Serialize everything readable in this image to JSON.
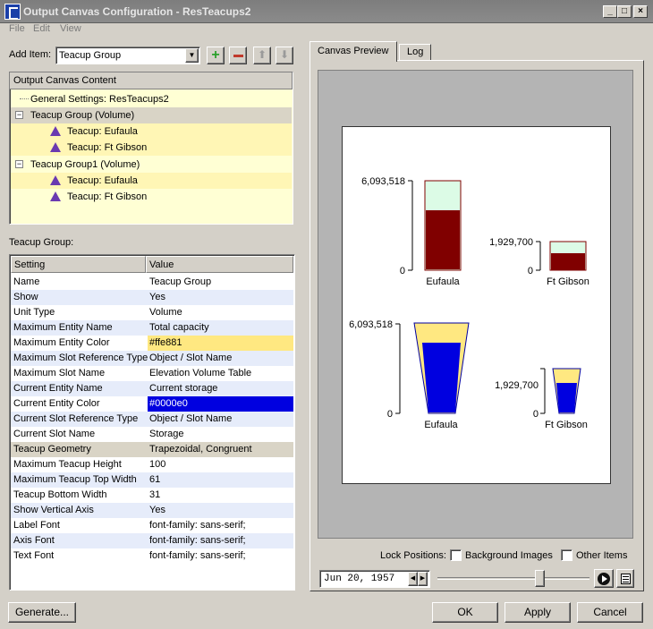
{
  "window": {
    "title": "Output Canvas Configuration - ResTeacups2"
  },
  "menu": [
    "File",
    "Edit",
    "View"
  ],
  "add_item": {
    "label": "Add Item:",
    "value": "Teacup Group"
  },
  "tree": {
    "header": "Output Canvas Content",
    "items": [
      {
        "label": "General Settings: ResTeacups2"
      },
      {
        "label": "Teacup Group (Volume)"
      },
      {
        "label": "Teacup: Eufaula"
      },
      {
        "label": "Teacup: Ft Gibson"
      },
      {
        "label": "Teacup Group1 (Volume)"
      },
      {
        "label": "Teacup: Eufaula"
      },
      {
        "label": "Teacup: Ft Gibson"
      }
    ]
  },
  "props": {
    "section_label": "Teacup Group:",
    "col_setting": "Setting",
    "col_value": "Value",
    "rows": [
      {
        "k": "Name",
        "v": "Teacup Group"
      },
      {
        "k": "Show",
        "v": "Yes"
      },
      {
        "k": "Unit Type",
        "v": "Volume"
      },
      {
        "k": "Maximum Entity Name",
        "v": "Total capacity"
      },
      {
        "k": "Maximum Entity Color",
        "v": "#ffe881"
      },
      {
        "k": "Maximum Slot Reference Type",
        "v": "Object / Slot Name"
      },
      {
        "k": "Maximum Slot Name",
        "v": "Elevation Volume Table"
      },
      {
        "k": "Current Entity Name",
        "v": "Current storage"
      },
      {
        "k": "Current Entity Color",
        "v": "#0000e0"
      },
      {
        "k": "Current Slot Reference Type",
        "v": "Object / Slot Name"
      },
      {
        "k": "Current Slot Name",
        "v": "Storage"
      },
      {
        "k": "Teacup Geometry",
        "v": "Trapezoidal, Congruent"
      },
      {
        "k": "Maximum Teacup Height",
        "v": "100"
      },
      {
        "k": "Maximum Teacup Top Width",
        "v": "61"
      },
      {
        "k": "Teacup Bottom Width",
        "v": "31"
      },
      {
        "k": "Show Vertical Axis",
        "v": "Yes"
      },
      {
        "k": "Label Font",
        "v": "font-family: sans-serif;"
      },
      {
        "k": "Axis Font",
        "v": "font-family: sans-serif;"
      },
      {
        "k": "Text Font",
        "v": "font-family: sans-serif;"
      }
    ]
  },
  "tabs": [
    "Canvas Preview",
    "Log"
  ],
  "preview": {
    "group1": [
      {
        "name": "Eufaula",
        "max": "6,093,518",
        "zero": "0",
        "fill_fraction": 0.69
      },
      {
        "name": "Ft Gibson",
        "max": "1,929,700",
        "zero": "0",
        "fill_fraction": 0.59
      }
    ],
    "group2": [
      {
        "name": "Eufaula",
        "max": "6,093,518",
        "zero": "0",
        "fill_fraction": 0.8
      },
      {
        "name": "Ft Gibson",
        "max": "1,929,700",
        "zero": "0",
        "fill_fraction": 0.62
      }
    ],
    "colors": {
      "max_fill_1": "#dcfbe6",
      "cur_fill_1": "#800000",
      "max_fill_2": "#ffe881",
      "cur_fill_2": "#0000e0"
    }
  },
  "lock": {
    "label": "Lock Positions:",
    "bg": "Background Images",
    "other": "Other Items"
  },
  "date": {
    "value": "Jun 20, 1957"
  },
  "buttons": {
    "generate": "Generate...",
    "ok": "OK",
    "apply": "Apply",
    "cancel": "Cancel"
  }
}
